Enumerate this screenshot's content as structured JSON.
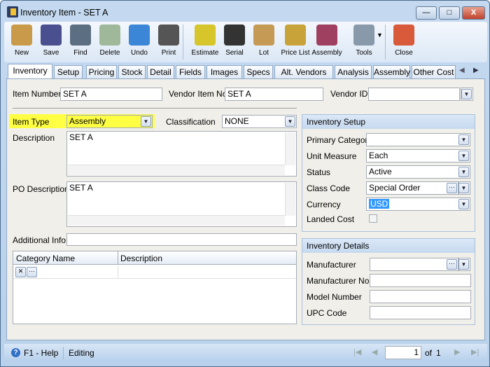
{
  "window": {
    "title": "Inventory Item - SET A",
    "minimize": "—",
    "maximize": "□",
    "close": "X"
  },
  "toolbar": [
    {
      "label": "New",
      "icon": "new-icon",
      "color": "#c89a4a"
    },
    {
      "label": "Save",
      "icon": "save-icon",
      "color": "#4a4f8f"
    },
    {
      "label": "Find",
      "icon": "find-icon",
      "color": "#5c6f82"
    },
    {
      "label": "Delete",
      "icon": "delete-icon",
      "color": "#9fb89a"
    },
    {
      "label": "Undo",
      "icon": "undo-icon",
      "color": "#3b86d6"
    },
    {
      "label": "Print",
      "icon": "print-icon",
      "color": "#555"
    },
    {
      "label": "Estimate",
      "icon": "estimate-icon",
      "color": "#d6c52b"
    },
    {
      "label": "Serial",
      "icon": "serial-icon",
      "color": "#333"
    },
    {
      "label": "Lot",
      "icon": "lot-icon",
      "color": "#c59a55"
    },
    {
      "label": "Price List",
      "icon": "price-list-icon",
      "color": "#c8a33a"
    },
    {
      "label": "Assembly",
      "icon": "assembly-icon",
      "color": "#a04060"
    },
    {
      "label": "Tools",
      "icon": "tools-icon",
      "color": "#8899aa"
    },
    {
      "label": "Close",
      "icon": "close-form-icon",
      "color": "#d85a3a"
    }
  ],
  "tabs": [
    "Inventory",
    "Setup",
    "Pricing",
    "Stock",
    "Detail",
    "Fields",
    "Images",
    "Specs",
    "Alt. Vendors",
    "Analysis",
    "Assembly",
    "Other Cost"
  ],
  "form": {
    "item_number_label": "Item Number",
    "item_number": "SET A",
    "vendor_item_no_label": "Vendor Item No",
    "vendor_item_no": "SET A",
    "vendor_id_label": "Vendor ID",
    "vendor_id": "",
    "item_type_label": "Item Type",
    "item_type": "Assembly",
    "classification_label": "Classification",
    "classification": "NONE",
    "description_label": "Description",
    "description": "SET A",
    "po_description_label": "PO Description",
    "po_description": "SET A",
    "additional_info_label": "Additional Info",
    "additional_info": "",
    "grid_headers": [
      "Category Name",
      "Description"
    ]
  },
  "inventory_setup": {
    "title": "Inventory Setup",
    "primary_category_label": "Primary Category",
    "primary_category": "",
    "unit_measure_label": "Unit Measure",
    "unit_measure": "Each",
    "status_label": "Status",
    "status": "Active",
    "class_code_label": "Class Code",
    "class_code": "Special Order",
    "currency_label": "Currency",
    "currency": "USD",
    "landed_cost_label": "Landed Cost",
    "landed_cost": false
  },
  "inventory_details": {
    "title": "Inventory Details",
    "manufacturer_label": "Manufacturer",
    "manufacturer": "",
    "manufacturer_no_label": "Manufacturer No",
    "manufacturer_no": "",
    "model_number_label": "Model Number",
    "model_number": "",
    "upc_code_label": "UPC Code",
    "upc_code": ""
  },
  "status_bar": {
    "help": "F1 - Help",
    "mode": "Editing",
    "page": "1",
    "of_label": "of",
    "total": "1"
  },
  "colors": {
    "highlight": "#ffff44",
    "selection": "#3399ff"
  }
}
